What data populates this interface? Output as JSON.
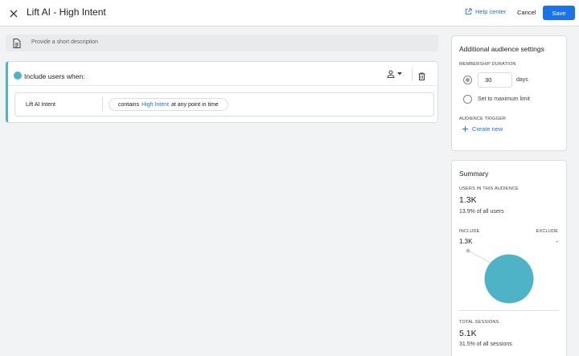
{
  "header": {
    "title": "Lift AI - High Intent",
    "help_label": "Help center",
    "cancel_label": "Cancel",
    "save_label": "Save"
  },
  "description": {
    "placeholder": "Provide a short description"
  },
  "condition_group": {
    "heading": "Include users when:",
    "condition": {
      "name": "Lift AI Intent",
      "operator": "contains",
      "value": "High Intent",
      "scope": "at any point in time"
    }
  },
  "settings": {
    "title": "Additional audience settings",
    "membership_duration_label": "MEMBERSHIP DURATION",
    "duration_value": "30",
    "duration_unit": "days",
    "max_limit_label": "Set to maximum limit",
    "audience_trigger_label": "AUDIENCE TRIGGER",
    "create_new_label": "Create new"
  },
  "summary": {
    "title": "Summary",
    "users_label": "USERS IN THIS AUDIENCE",
    "users_value": "1.3K",
    "users_pct": "13.9% of all users",
    "include_label": "INCLUDE",
    "exclude_label": "EXCLUDE",
    "include_value": "1.3K",
    "exclude_value": "-",
    "sessions_label": "TOTAL SESSIONS",
    "sessions_value": "5.1K",
    "sessions_pct": "31.5% of all sessions"
  },
  "colors": {
    "accent": "#1a73e8",
    "include_color": "#4fb3c8"
  }
}
